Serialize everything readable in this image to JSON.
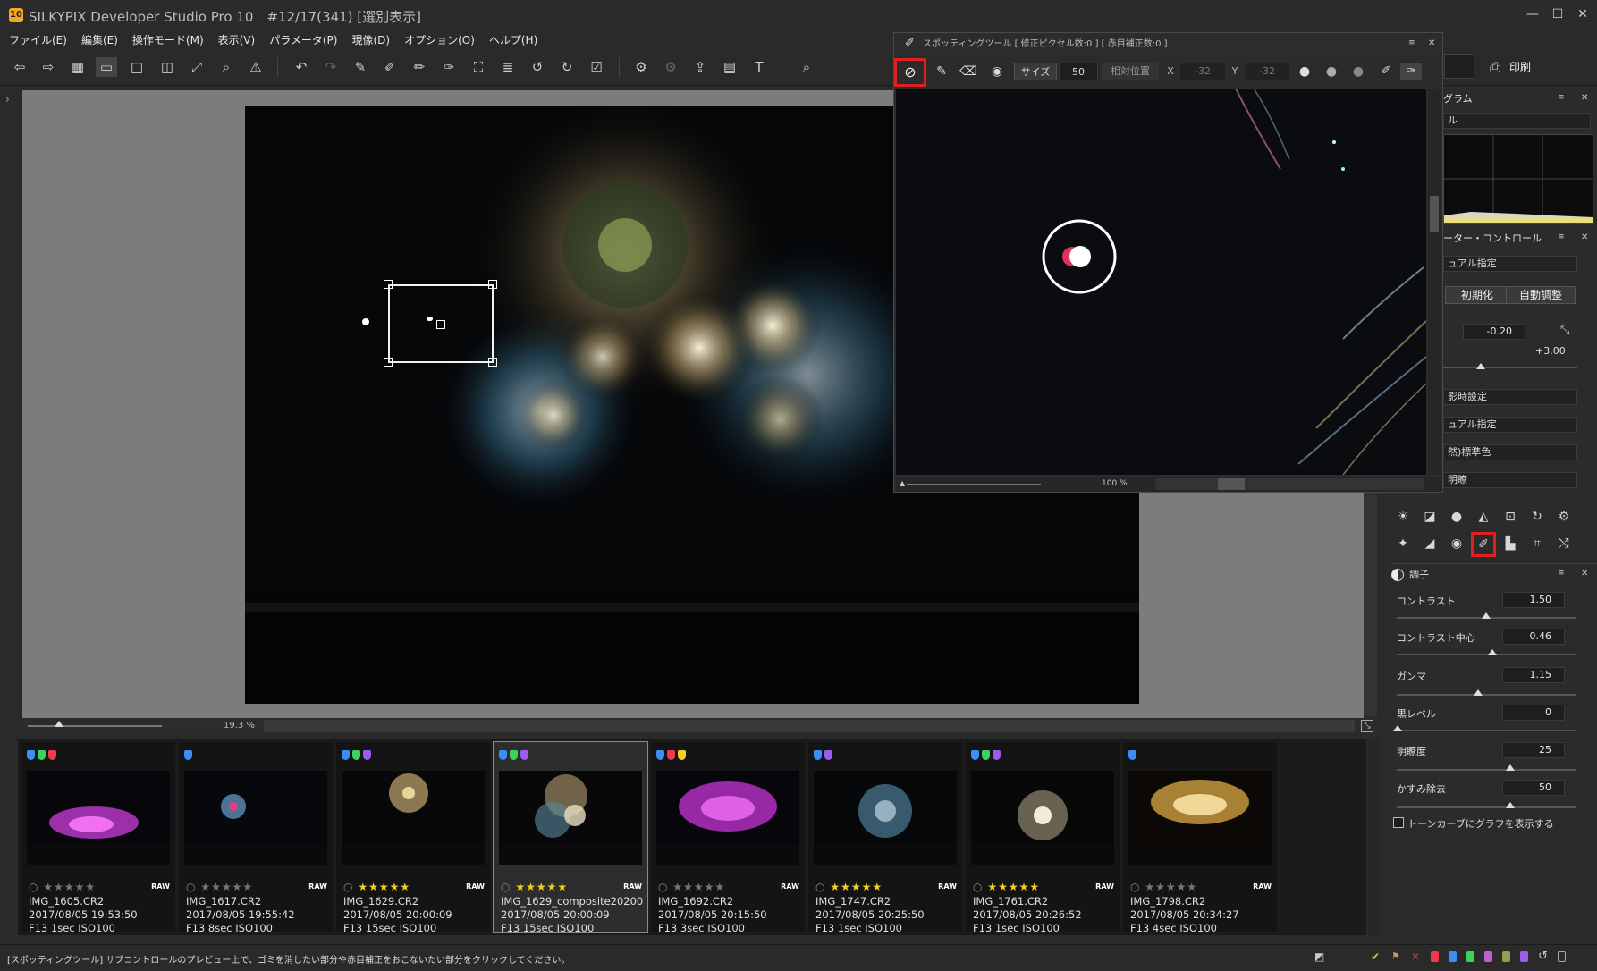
{
  "window": {
    "icon_text": "10",
    "title": "SILKYPIX Developer Studio Pro 10　#12/17(341) [選別表示]",
    "controls": [
      "—",
      "☐",
      "✕"
    ]
  },
  "menu": [
    "ファイル(E)",
    "編集(E)",
    "操作モード(M)",
    "表示(V)",
    "パラメータ(P)",
    "現像(D)",
    "オプション(O)",
    "ヘルプ(H)"
  ],
  "toolbar": {
    "print_label": "印刷"
  },
  "preview": {
    "zoom_value": "19.3",
    "zoom_unit": "%"
  },
  "spot_tool": {
    "title": "スポッティングツール [ 修正ピクセル数:0 ] [ 赤目補正数:0 ]",
    "size_label": "サイズ",
    "size_value": "50",
    "relative_label": "相対位置",
    "x_label": "X",
    "x_value": "-32",
    "y_label": "Y",
    "y_value": "-32",
    "zoom_value": "100",
    "zoom_unit": "%"
  },
  "thumbnails": [
    {
      "name": "IMG_1605.CR2",
      "date": "2017/08/05 19:53:50",
      "exif": "F13 1sec ISO100",
      "rating": 0,
      "tags": [
        "#3a8ef5",
        "#3bd45a",
        "#ef3a4e"
      ],
      "raw": "RAW",
      "selected": false
    },
    {
      "name": "IMG_1617.CR2",
      "date": "2017/08/05 19:55:42",
      "exif": "F13 8sec ISO100",
      "rating": 0,
      "tags": [
        "#3a8ef5"
      ],
      "raw": "RAW",
      "selected": false
    },
    {
      "name": "IMG_1629.CR2",
      "date": "2017/08/05 20:00:09",
      "exif": "F13 15sec ISO100",
      "rating": 5,
      "tags": [
        "#3a8ef5",
        "#3bd45a",
        "#9b5cf0"
      ],
      "raw": "RAW",
      "selected": false
    },
    {
      "name": "IMG_1629_composite20200",
      "date": "2017/08/05 20:00:09",
      "exif": "F13 15sec ISO100",
      "rating": 5,
      "tags": [
        "#3a8ef5",
        "#3bd45a",
        "#9b5cf0"
      ],
      "raw": "RAW",
      "selected": true
    },
    {
      "name": "IMG_1692.CR2",
      "date": "2017/08/05 20:15:50",
      "exif": "F13 3sec ISO100",
      "rating": 0,
      "tags": [
        "#3a8ef5",
        "#ef3a4e",
        "#f0d020"
      ],
      "raw": "RAW",
      "selected": false
    },
    {
      "name": "IMG_1747.CR2",
      "date": "2017/08/05 20:25:50",
      "exif": "F13 1sec ISO100",
      "rating": 5,
      "tags": [
        "#3a8ef5",
        "#9b5cf0"
      ],
      "raw": "RAW",
      "selected": false
    },
    {
      "name": "IMG_1761.CR2",
      "date": "2017/08/05 20:26:52",
      "exif": "F13 1sec ISO100",
      "rating": 5,
      "tags": [
        "#3a8ef5",
        "#3bd45a",
        "#9b5cf0"
      ],
      "raw": "RAW",
      "selected": false
    },
    {
      "name": "IMG_1798.CR2",
      "date": "2017/08/05 20:34:27",
      "exif": "F13 4sec ISO100",
      "rating": 0,
      "tags": [
        "#3a8ef5"
      ],
      "raw": "RAW",
      "selected": false
    }
  ],
  "right_panel": {
    "histogram_title": "グラム",
    "histogram_dropdown": "ル",
    "param_title": "ーター・コントロール",
    "manual_select": "ュアル指定",
    "init_button": "初期化",
    "auto_button": "自動調整",
    "exposure_value": "-0.20",
    "exposure_max": "+3.00",
    "dd_white_balance": "影時設定",
    "dd_manual2": "ュアル指定",
    "dd_color": "然)標準色",
    "dd_sharp": "明瞭",
    "tone_title": "調子",
    "sliders": [
      {
        "label": "コントラスト",
        "value": "1.50"
      },
      {
        "label": "コントラスト中心",
        "value": "0.46"
      },
      {
        "label": "ガンマ",
        "value": "1.15"
      },
      {
        "label": "黒レベル",
        "value": "0"
      },
      {
        "label": "明瞭度",
        "value": "25"
      },
      {
        "label": "かすみ除去",
        "value": "50"
      }
    ],
    "tone_curve_checkbox": "トーンカーブにグラフを表示する"
  },
  "status": {
    "message": "[スポッティングツール] サブコントロールのプレビュー上で、ゴミを消したい部分や赤目補正をおこないたい部分をクリックしてください。"
  }
}
